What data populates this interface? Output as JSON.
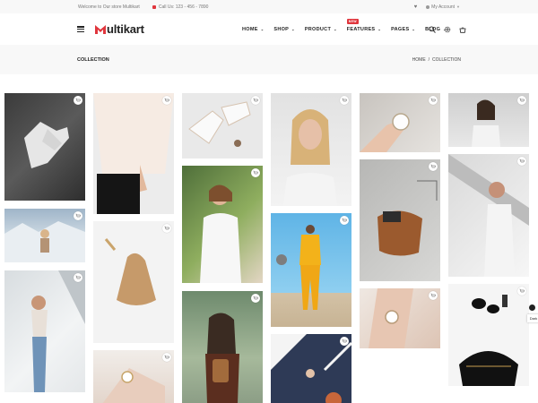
{
  "topbar": {
    "welcome": "Welcome to Our store Multikart",
    "phone": "Call Us: 123 - 456 - 7890",
    "account": "My Account"
  },
  "header": {
    "logo_initial": "M",
    "logo_rest": "ultikart",
    "nav": [
      {
        "label": "HOME"
      },
      {
        "label": "SHOP"
      },
      {
        "label": "PRODUCT"
      },
      {
        "label": "FEATURES",
        "badge": "NEW"
      },
      {
        "label": "PAGES"
      },
      {
        "label": "BLOG"
      }
    ]
  },
  "breadcrumb": {
    "title": "COLLECTION",
    "home": "HOME",
    "separator": "/",
    "current": "COLLECTION"
  },
  "side_tools": {
    "dark_label": "Dark"
  },
  "colors": {
    "accent": "#e0363d",
    "bar_bg": "#f8f8f8"
  }
}
